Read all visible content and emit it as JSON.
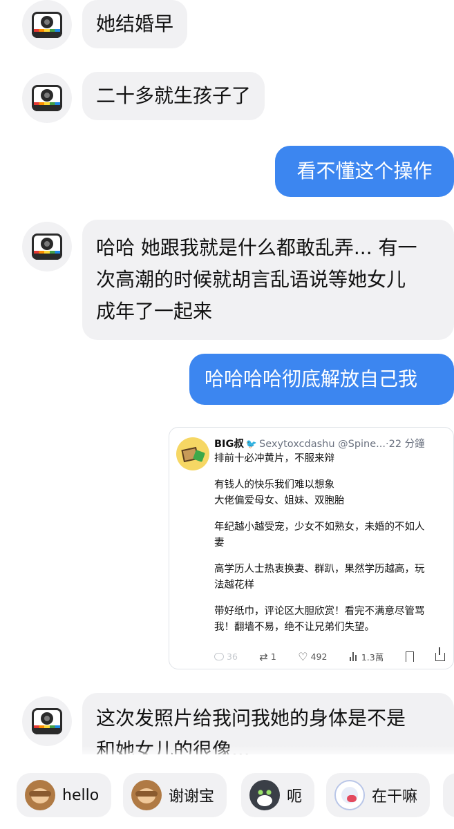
{
  "messages": [
    {
      "from": "other",
      "text": "她结婚早"
    },
    {
      "from": "other",
      "text": "二十多就生孩子了"
    },
    {
      "from": "me",
      "text": "看不懂这个操作"
    },
    {
      "from": "other",
      "lines": [
        "哈哈 她跟我就是什么都敢乱弄... 有一",
        "次高潮的时候就胡言乱语说等她女儿",
        "成年了一起来"
      ]
    },
    {
      "from": "me",
      "text": "哈哈哈哈彻底解放自己我"
    },
    {
      "from": "other",
      "lines": [
        "这次发照片给我问我她的身体是不是",
        "和她女儿的很像..."
      ]
    }
  ],
  "tweet": {
    "name": "BIG叔",
    "bird": "🐦",
    "handle_meta": "Sexytoxcdashu @Spine...·22 分鐘",
    "paragraphs": [
      [
        "排前十必冲黄片，不服来辩"
      ],
      [
        "有钱人的快乐我们难以想象",
        "大佬偏爱母女、姐妹、双胞胎"
      ],
      [
        "年纪越小越受宠，少女不如熟女，未婚的不如人",
        "妻"
      ],
      [
        "高学历人士热衷换妻、群趴，果然学历越高，玩",
        "法越花样"
      ],
      [
        "带好纸巾，评论区大胆欣赏！看完不满意尽管骂",
        "我！翻墙不易，绝不让兄弟们失望。"
      ]
    ],
    "stats": {
      "replies": "36",
      "retweets": "1",
      "likes": "492",
      "views": "1.3萬"
    }
  },
  "quick_replies": [
    {
      "label": "hello",
      "icon": "monkey-emoji-icon"
    },
    {
      "label": "谢谢宝",
      "icon": "monkey-flower-emoji-icon"
    },
    {
      "label": "呃",
      "icon": "cat-emoji-icon"
    },
    {
      "label": "在干嘛",
      "icon": "face-emoji-icon"
    }
  ],
  "colors": {
    "outgoing_bubble": "#3c86f0",
    "incoming_bubble": "#f1f1f3"
  }
}
